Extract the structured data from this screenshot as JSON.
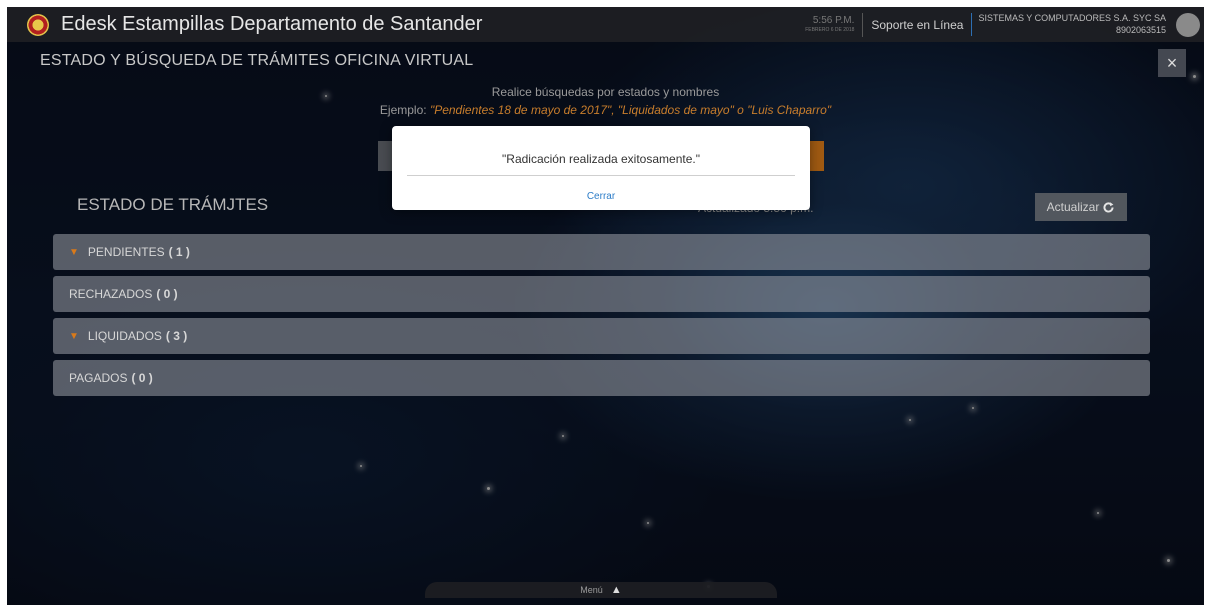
{
  "header": {
    "app_title": "Edesk Estampillas Departamento de Santander",
    "clock_time": "5:56 P.M.",
    "clock_date": "FEBRERO 6 DE 2018",
    "support_label": "Soporte en Línea",
    "company_name": "SISTEMAS Y COMPUTADORES S.A. SYC SA",
    "company_id": "8902063515"
  },
  "panel": {
    "title": "ESTADO Y BÚSQUEDA DE TRÁMITES OFICINA VIRTUAL",
    "close_icon": "×",
    "hint_line1": "Realice búsquedas por estados y nombres",
    "hint_prefix": "Ejemplo: ",
    "hint_examples": "\"Pendientes 18 de mayo de 2017\", \"Liquidados de mayo\" o \"Luis Chaparro\""
  },
  "status": {
    "section_title": "ESTADO DE TRÁMJTES",
    "updated_text": "Actualizado 5:56 p.m.",
    "refresh_label": "Actualizar",
    "items": [
      {
        "label": "PENDIENTES",
        "count": "( 1 )",
        "expandable": true
      },
      {
        "label": "RECHAZADOS",
        "count": "( 0 )",
        "expandable": false
      },
      {
        "label": "LIQUIDADOS",
        "count": "( 3 )",
        "expandable": true
      },
      {
        "label": "PAGADOS",
        "count": "( 0 )",
        "expandable": false
      }
    ]
  },
  "modal": {
    "message": "\"Radicación realizada exitosamente.\"",
    "close_label": "Cerrar"
  },
  "bottom_menu": {
    "label": "Menú",
    "icon": "▲"
  },
  "colors": {
    "accent_orange": "#d97a1a",
    "link_blue": "#2d7dc8"
  }
}
